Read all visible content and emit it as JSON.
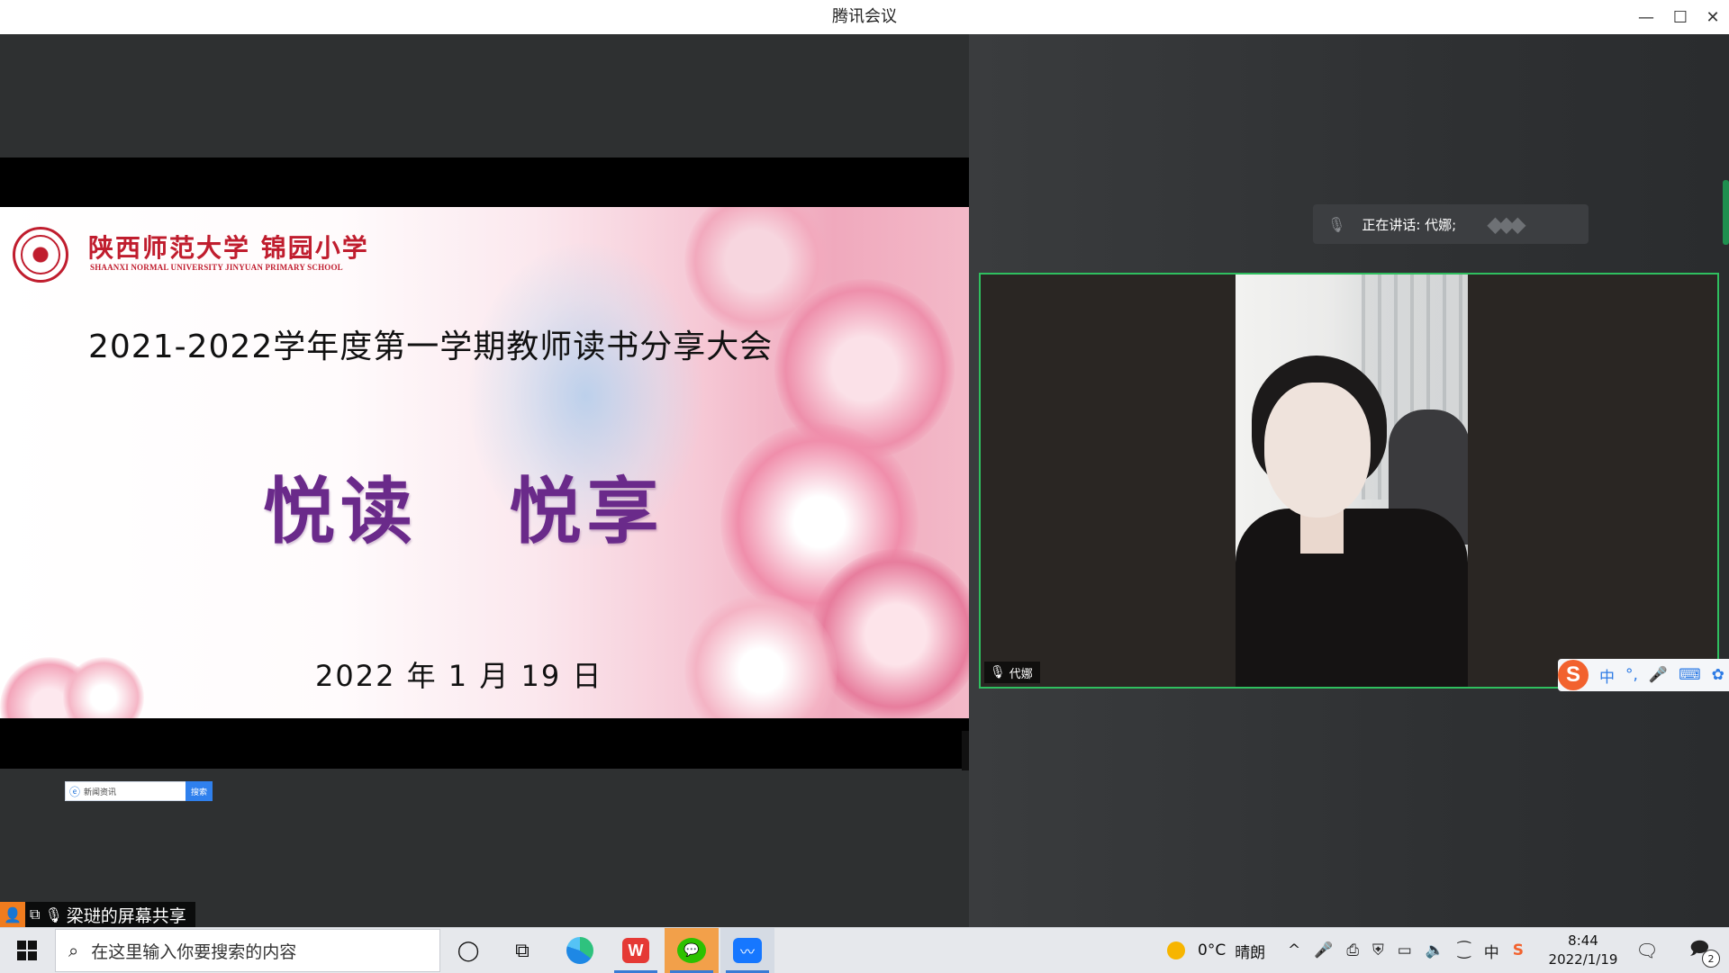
{
  "window": {
    "title": "腾讯会议",
    "controls": {
      "minimize": "—",
      "maximize": "☐",
      "close": "✕"
    }
  },
  "shared_slide": {
    "logo_text": "陕西师范大学 锦园小学",
    "logo_subtext": "SHAANXI NORMAL UNIVERSITY JINYUAN PRIMARY SCHOOL",
    "title": "2021-2022学年度第一学期教师读书分享大会",
    "main_text": "悦读   悦享",
    "date": "2022 年 1 月 19 日"
  },
  "mini_search": {
    "text": "新闻资讯",
    "button": "搜索"
  },
  "share_label": {
    "text": "梁琎的屏幕共享"
  },
  "speaking": {
    "label": "正在讲话: 代娜;"
  },
  "video": {
    "participant_name": "代娜"
  },
  "ime": {
    "items": [
      "中",
      "°,",
      "🎤",
      "⌨",
      "✿"
    ]
  },
  "taskbar": {
    "search_placeholder": "在这里输入你要搜索的内容",
    "weather_temp": "0°C",
    "weather_desc": "晴朗",
    "tray_icons": [
      "^",
      "🎤",
      "⎙",
      "⛨",
      "▭",
      "🔈",
      "⁐",
      "中",
      "S"
    ],
    "time": "8:44",
    "date": "2022/1/19",
    "notification_count": "2"
  }
}
